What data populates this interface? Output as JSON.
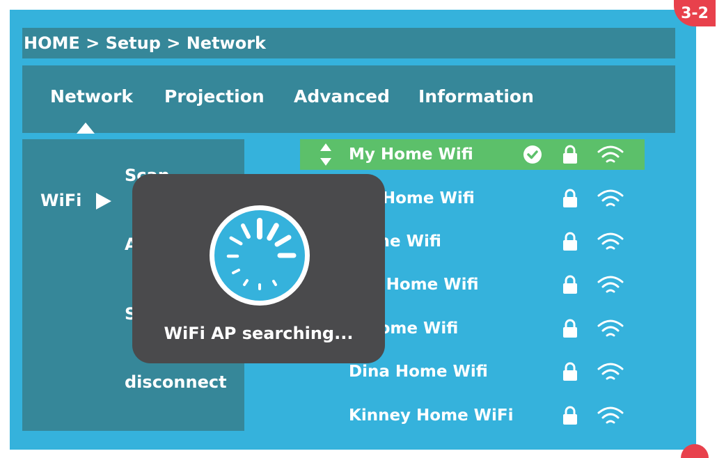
{
  "badge": "3-2",
  "breadcrumb": "HOME > Setup > Network",
  "tabs": [
    {
      "label": "Network",
      "active": true
    },
    {
      "label": "Projection"
    },
    {
      "label": "Advanced"
    },
    {
      "label": "Information"
    }
  ],
  "sidebar": {
    "category": "WiFi",
    "items": [
      "Scan",
      "A",
      "S",
      "disconnect"
    ]
  },
  "wifi_list": [
    {
      "name": "My Home Wifi",
      "connected": true,
      "locked": true
    },
    {
      "name": "nie Home Wifi",
      "connected": false,
      "locked": true
    },
    {
      "name": "Home Wifi",
      "connected": false,
      "locked": true
    },
    {
      "name": "nce Home Wifi",
      "connected": false,
      "locked": true
    },
    {
      "name": "n Home Wifi",
      "connected": false,
      "locked": true
    },
    {
      "name": "Dina Home Wifi",
      "connected": false,
      "locked": true
    },
    {
      "name": "Kinney Home WiFi",
      "connected": false,
      "locked": true
    }
  ],
  "overlay": {
    "message": "WiFi AP searching...",
    "icon": "loading-spinner-icon"
  },
  "colors": {
    "background": "#35b2dc",
    "panel": "#368799",
    "selected": "#5cc06a",
    "overlay": "#4a4a4c",
    "badge": "#e8414c"
  }
}
